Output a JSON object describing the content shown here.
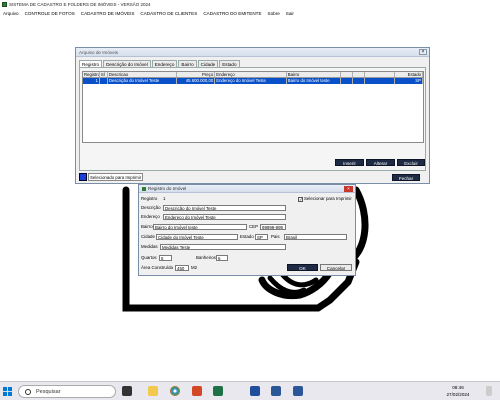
{
  "app": {
    "title": "SISTEMA DE CADASTRO E FOLDERS DE IMÓVEIS - VERSÃO 2024",
    "menu": [
      "Arquivo",
      "CONTROLE DE FOTOS",
      "CADASTRO DE IMÓVEIS",
      "CADASTRO DE CLIENTES",
      "CADASTRO DO EMITENTE",
      "Sobre",
      "Sair"
    ]
  },
  "main_window": {
    "title": "Arquivo de Imóveis",
    "close_glyph": "×",
    "tabs": [
      "Registro",
      "Descrição do Imóvel",
      "Endereço",
      "Bairro",
      "Cidade",
      "Estado"
    ],
    "grid": {
      "headers": [
        "Registro",
        "Sl",
        "Descricao",
        "Preço",
        "Endereço",
        "Bairro",
        "",
        "",
        "",
        "Estado"
      ],
      "rows": [
        {
          "registro": "1",
          "sl": "",
          "descricao": "Descrição do Imóvel Teste",
          "preco": "45.600.000,00",
          "endereco": "Endereço do Imóvel Teste",
          "bairro": "Bairro do Imóvel teste",
          "estado": "SP",
          "selected": true
        }
      ]
    },
    "buttons": {
      "inserir": "Inserir",
      "alterar": "Alterar",
      "excluir": "Excluir",
      "fechar": "Fechar"
    },
    "legend_label": "Selecionado para Imprimir",
    "legend_color": "#1a3ed6"
  },
  "dialog": {
    "title": "Registro do Imóvel",
    "close_glyph": "×",
    "registro": {
      "label": "Registro",
      "value": "1"
    },
    "selecionar": {
      "label": "Selecionar para Imprimir",
      "checked": true,
      "mark": "✓"
    },
    "descricao": {
      "label": "Descrição",
      "value": "Descrição do Imóvel Teste"
    },
    "endereco": {
      "label": "Endereço",
      "value": "Endereço do Imóvel Teste"
    },
    "bairro": {
      "label": "Bairro",
      "value": "Bairro do Imóvel teste"
    },
    "cep": {
      "label": "CEP",
      "value": "99999-999"
    },
    "cidade": {
      "label": "Cidade",
      "value": "Cidade do Imóvel Teste"
    },
    "estado": {
      "label": "Estado",
      "value": "SP"
    },
    "pais": {
      "label": "Pais",
      "value": "Brasil"
    },
    "medidas": {
      "label": "Medidas",
      "value": "Medidas Teste"
    },
    "quartos": {
      "label": "Quartos",
      "value": "5"
    },
    "banheiros": {
      "label": "Banheiros",
      "value": "6"
    },
    "area": {
      "label": "Área Construída",
      "value": "450",
      "unit": "M2"
    },
    "buttons": {
      "ok": "OK",
      "cancel": "Cancelar"
    }
  },
  "taskbar": {
    "search_placeholder": "Pesquisar",
    "icons": [
      "windows-start-icon",
      "file-explorer-icon",
      "chrome-icon",
      "powerpoint-icon",
      "excel-icon",
      "app-folder-icon",
      "app-icon",
      "word-icon"
    ],
    "time": "08:46",
    "date": "27/02/2024"
  }
}
